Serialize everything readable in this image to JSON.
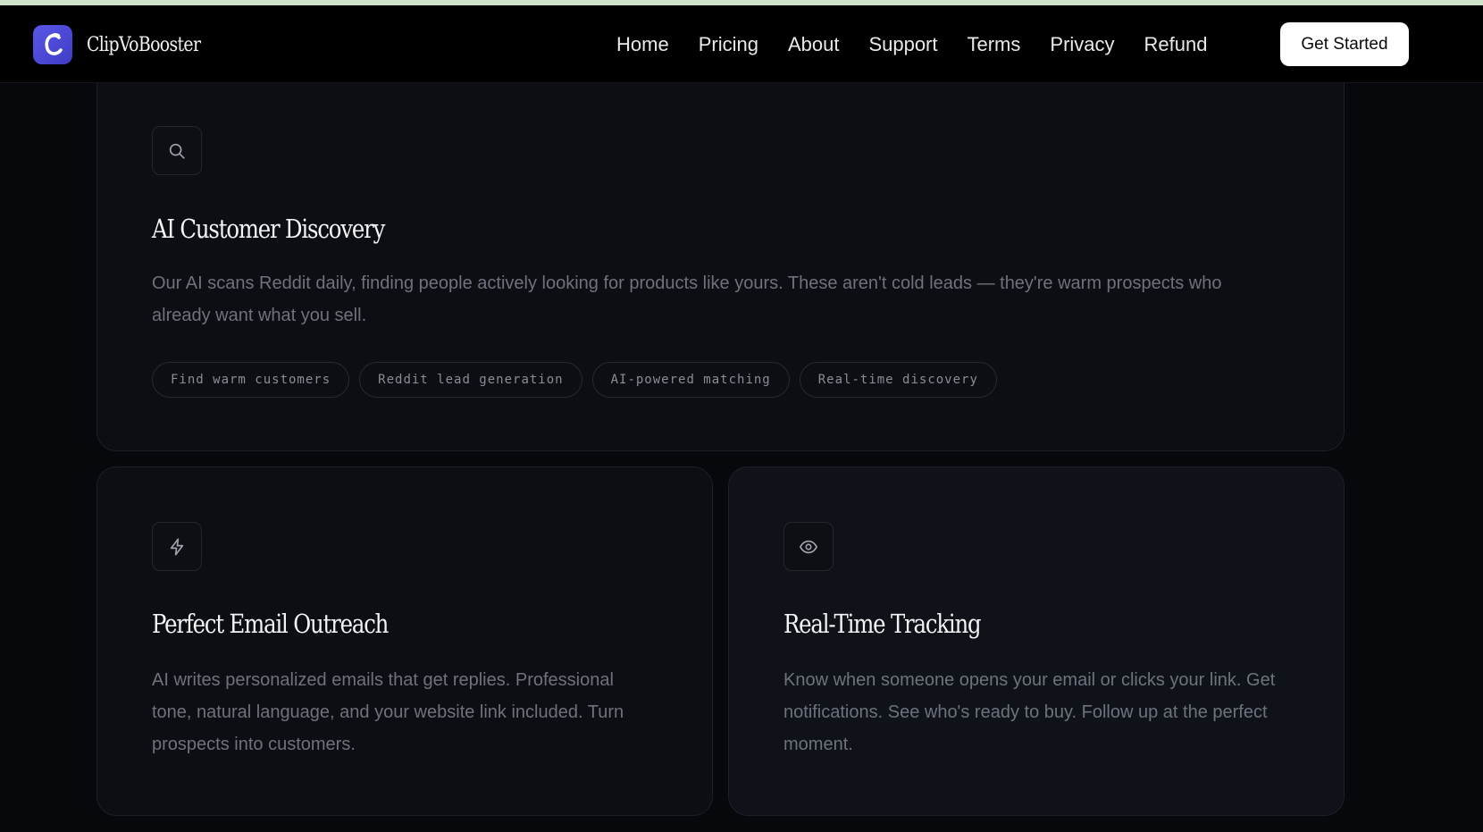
{
  "brand": {
    "name": "ClipVoBooster",
    "logo_icon": "c-letter-logo-icon",
    "logo_color": "#4f4cd9"
  },
  "nav": {
    "links": [
      "Home",
      "Pricing",
      "About",
      "Support",
      "Terms",
      "Privacy",
      "Refund"
    ],
    "cta_label": "Get Started"
  },
  "features": {
    "discovery": {
      "icon": "search-icon",
      "title": "AI Customer Discovery",
      "description": "Our AI scans Reddit daily, finding people actively looking for products like yours. These aren't cold leads — they're warm prospects who already want what you sell.",
      "tags": [
        "Find warm customers",
        "Reddit lead generation",
        "AI-powered matching",
        "Real-time discovery"
      ]
    },
    "outreach": {
      "icon": "lightning-icon",
      "title": "Perfect Email Outreach",
      "description": "AI writes personalized emails that get replies. Professional tone, natural language, and your website link included. Turn prospects into customers."
    },
    "tracking": {
      "icon": "eye-icon",
      "title": "Real-Time Tracking",
      "description": "Know when someone opens your email or clicks your link. Get notifications. See who's ready to buy. Follow up at the perfect moment."
    }
  }
}
